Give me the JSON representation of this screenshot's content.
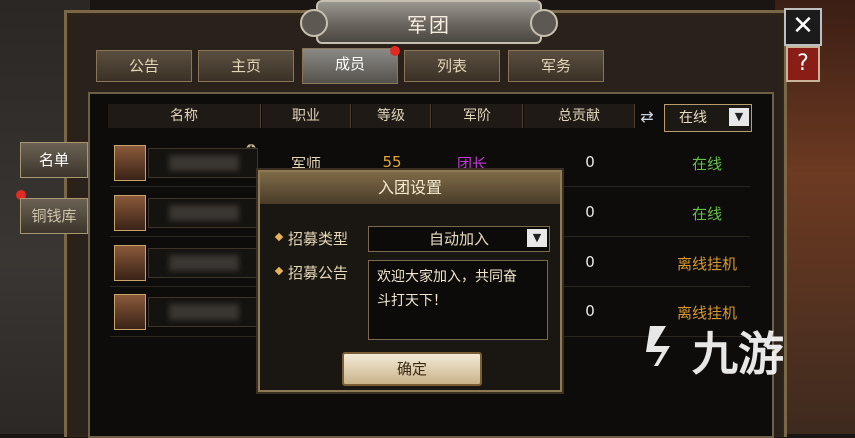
{
  "window": {
    "title": "军团"
  },
  "buttons": {
    "close": "✕",
    "help": "?"
  },
  "tabs": [
    {
      "label": "公告"
    },
    {
      "label": "主页"
    },
    {
      "label": "成员"
    },
    {
      "label": "列表"
    },
    {
      "label": "军务"
    }
  ],
  "side": {
    "roster": "名单",
    "coin_store": "铜钱库"
  },
  "table": {
    "headers": [
      "名称",
      "职业",
      "等级",
      "军阶",
      "总贡献"
    ],
    "filter": "在线",
    "rows": [
      {
        "job": "军师",
        "level": "55",
        "rank": "团长",
        "contribution": "0",
        "status": "在线"
      },
      {
        "job": "",
        "level": "",
        "rank": "",
        "contribution": "0",
        "status": "在线"
      },
      {
        "job": "",
        "level": "",
        "rank": "",
        "contribution": "0",
        "status": "离线挂机"
      },
      {
        "job": "",
        "level": "",
        "rank": "",
        "contribution": "0",
        "status": "离线挂机"
      }
    ]
  },
  "dialog": {
    "title": "入团设置",
    "recruit_type_label": "招募类型",
    "recruit_type_value": "自动加入",
    "recruit_notice_label": "招募公告",
    "recruit_notice_text": "欢迎大家加入，共同奋\n斗打天下！",
    "confirm": "确定"
  },
  "watermark": {
    "text": "九游"
  },
  "colors": {
    "online": "#65c04a",
    "offline": "#d89a2c",
    "rank": "#c23ad4",
    "level": "#e0a63a"
  }
}
